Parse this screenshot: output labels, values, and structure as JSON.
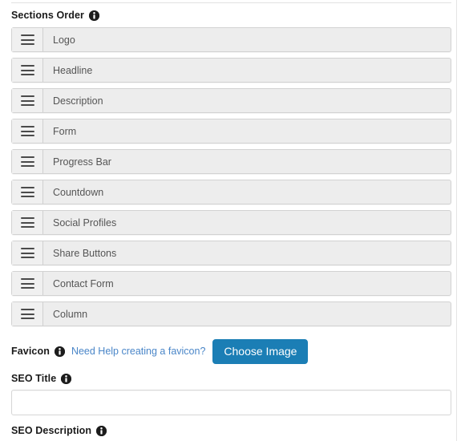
{
  "panel": {
    "accent_color": "#1b7eb5",
    "link_color": "#4a86c8",
    "item_bg_color": "#ededed"
  },
  "sections_order": {
    "label": "Sections Order",
    "info_icon": "info-icon",
    "drag_icon": "drag-handle-icon",
    "items": [
      {
        "label": "Logo"
      },
      {
        "label": "Headline"
      },
      {
        "label": "Description"
      },
      {
        "label": "Form"
      },
      {
        "label": "Progress Bar"
      },
      {
        "label": "Countdown"
      },
      {
        "label": "Social Profiles"
      },
      {
        "label": "Share Buttons"
      },
      {
        "label": "Contact Form"
      },
      {
        "label": "Column"
      }
    ]
  },
  "favicon": {
    "label": "Favicon",
    "info_icon": "info-icon",
    "help_link": "Need Help creating a favicon?",
    "choose_button": "Choose Image"
  },
  "seo_title": {
    "label": "SEO Title",
    "info_icon": "info-icon",
    "value": "",
    "placeholder": ""
  },
  "seo_description": {
    "label": "SEO Description",
    "info_icon": "info-icon"
  }
}
